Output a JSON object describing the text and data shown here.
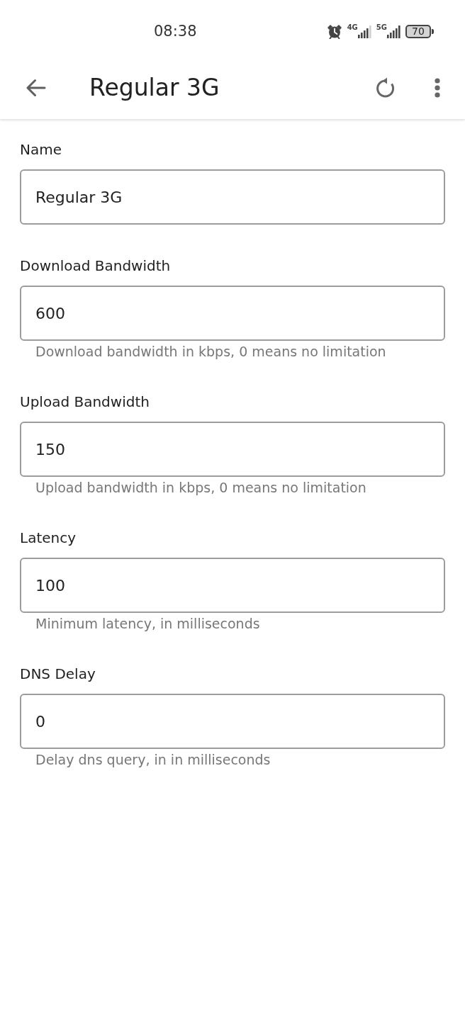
{
  "status_bar": {
    "time": "08:38",
    "networks": [
      {
        "label": "4G"
      },
      {
        "label": "5G"
      }
    ],
    "battery": "70"
  },
  "app_bar": {
    "title": "Regular 3G"
  },
  "fields": [
    {
      "label": "Name",
      "value": "Regular 3G"
    },
    {
      "label": "Download Bandwidth",
      "value": "600",
      "helper": "Download bandwidth in kbps, 0 means no limitation"
    },
    {
      "label": "Upload Bandwidth",
      "value": "150",
      "helper": "Upload bandwidth in kbps, 0 means no limitation"
    },
    {
      "label": "Latency",
      "value": "100",
      "helper": "Minimum latency, in milliseconds"
    },
    {
      "label": "DNS Delay",
      "value": "0",
      "helper": "Delay dns query, in in milliseconds"
    }
  ]
}
